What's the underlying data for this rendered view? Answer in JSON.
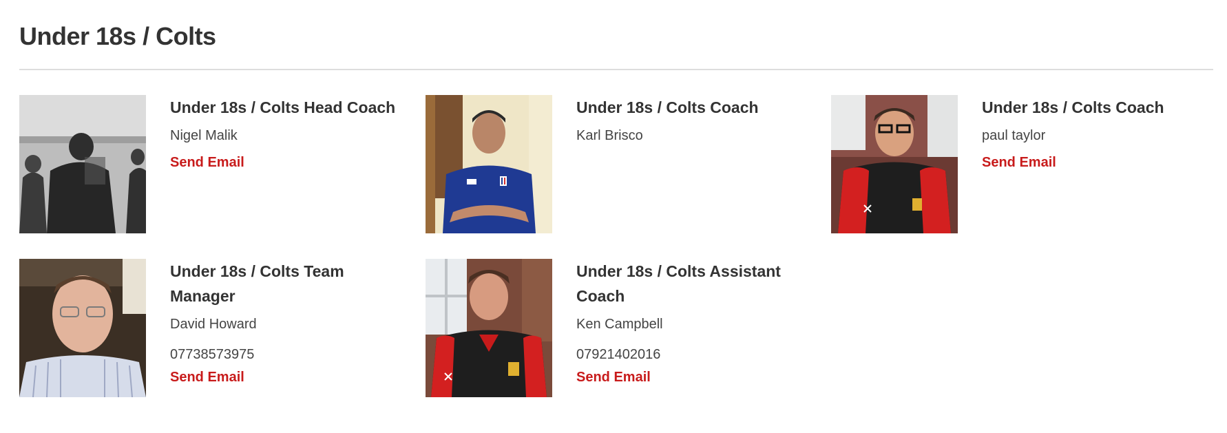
{
  "section": {
    "title": "Under 18s / Colts"
  },
  "contacts": [
    {
      "role": "Under 18s / Colts Head Coach",
      "name": "Nigel Malik",
      "phone": "",
      "email_label": "Send Email"
    },
    {
      "role": "Under 18s / Colts Coach",
      "name": "Karl Brisco",
      "phone": "",
      "email_label": ""
    },
    {
      "role": "Under 18s / Colts Coach",
      "name": "paul taylor",
      "phone": "",
      "email_label": "Send Email"
    },
    {
      "role": "Under 18s / Colts Team Manager",
      "name": "David Howard",
      "phone": "07738573975",
      "email_label": "Send Email"
    },
    {
      "role": "Under 18s / Colts Assistant Coach",
      "name": "Ken Campbell",
      "phone": "07921402016",
      "email_label": "Send Email"
    }
  ],
  "colors": {
    "email_link": "#c81b1b",
    "text": "#333333",
    "divider": "#dddddd"
  }
}
